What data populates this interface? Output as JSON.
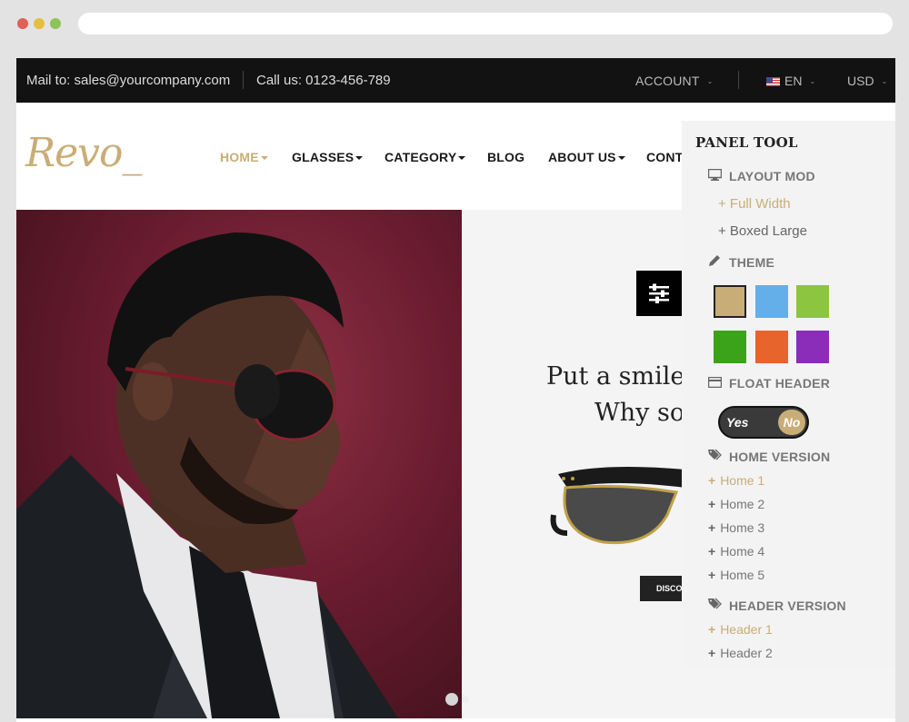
{
  "topbar": {
    "mail": "Mail to: sales@yourcompany.com",
    "call": "Call us: 0123-456-789",
    "account": "ACCOUNT",
    "language": "EN",
    "currency": "USD"
  },
  "logo": {
    "text": "Revo_"
  },
  "nav": {
    "items": [
      {
        "label": "HOME"
      },
      {
        "label": "GLASSES"
      },
      {
        "label": "CATEGORY"
      },
      {
        "label": "BLOG"
      },
      {
        "label": "ABOUT US"
      },
      {
        "label": "CONTA"
      }
    ]
  },
  "hero": {
    "headline_line1": "Put a smile",
    "headline_line2": "Why so",
    "button": "DISCOV"
  },
  "panel": {
    "title": "PANEL TOOL",
    "layout": {
      "title": "LAYOUT MOD",
      "options": [
        {
          "label": "+ Full Width"
        },
        {
          "label": "+ Boxed Large"
        }
      ]
    },
    "theme": {
      "title": "THEME",
      "colors": [
        "#c9ad76",
        "#64aee9",
        "#8cc540",
        "#3aa319",
        "#e7642c",
        "#8b2db8"
      ],
      "selected": "#c9ad76"
    },
    "float_header": {
      "title": "FLOAT HEADER",
      "yes": "Yes",
      "no": "No",
      "value": "No"
    },
    "home_version": {
      "title": "HOME VERSION",
      "items": [
        "Home 1",
        "Home 2",
        "Home 3",
        "Home 4",
        "Home 5"
      ]
    },
    "header_version": {
      "title": "HEADER VERSION",
      "items": [
        "Header 1",
        "Header 2"
      ]
    }
  },
  "colors": {
    "accent": "#c9ad76",
    "topbar": "#121212"
  }
}
